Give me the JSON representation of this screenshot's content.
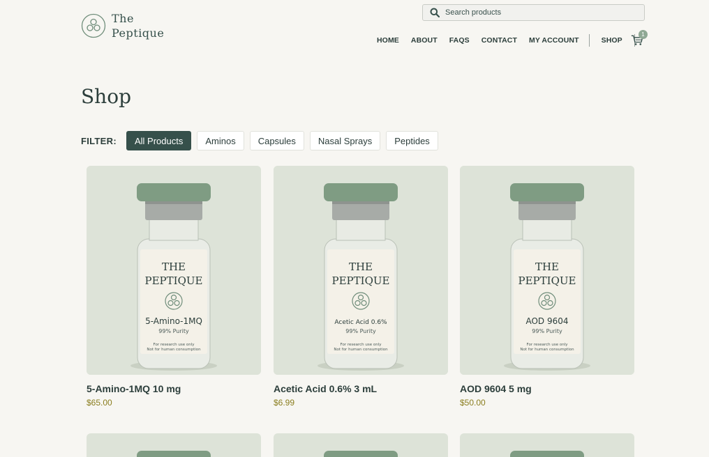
{
  "brand": {
    "line1": "The",
    "line2": "Peptique"
  },
  "search": {
    "placeholder": "Search products"
  },
  "nav": {
    "items": [
      "HOME",
      "ABOUT",
      "FAQS",
      "CONTACT",
      "MY ACCOUNT"
    ],
    "shop": "SHOP",
    "cart_count": "1"
  },
  "page_title": "Shop",
  "filter": {
    "label": "FILTER:",
    "options": [
      "All Products",
      "Aminos",
      "Capsules",
      "Nasal Sprays",
      "Peptides"
    ],
    "active": "All Products"
  },
  "products": [
    {
      "name": "5-Amino-1MQ 10 mg",
      "price": "$65.00",
      "label_brand1": "THE",
      "label_brand2": "PEPTIQUE",
      "label_name": "5-Amino-1MQ",
      "label_purity": "99% Purity",
      "label_note1": "For research use only",
      "label_note2": "Not for human consumption"
    },
    {
      "name": "Acetic Acid 0.6% 3 mL",
      "price": "$6.99",
      "label_brand1": "THE",
      "label_brand2": "PEPTIQUE",
      "label_name": "Acetic Acid 0.6%",
      "label_purity": "99% Purity",
      "label_note1": "For research use only",
      "label_note2": "Not for human consumption"
    },
    {
      "name": "AOD 9604 5 mg",
      "price": "$50.00",
      "label_brand1": "THE",
      "label_brand2": "PEPTIQUE",
      "label_name": "AOD 9604",
      "label_purity": "99% Purity",
      "label_note1": "For research use only",
      "label_note2": "Not for human consumption"
    }
  ],
  "colors": {
    "primary": "#36504b",
    "price": "#8a7d1e",
    "background": "#f7f6f2",
    "cap": "#7f9c83"
  }
}
